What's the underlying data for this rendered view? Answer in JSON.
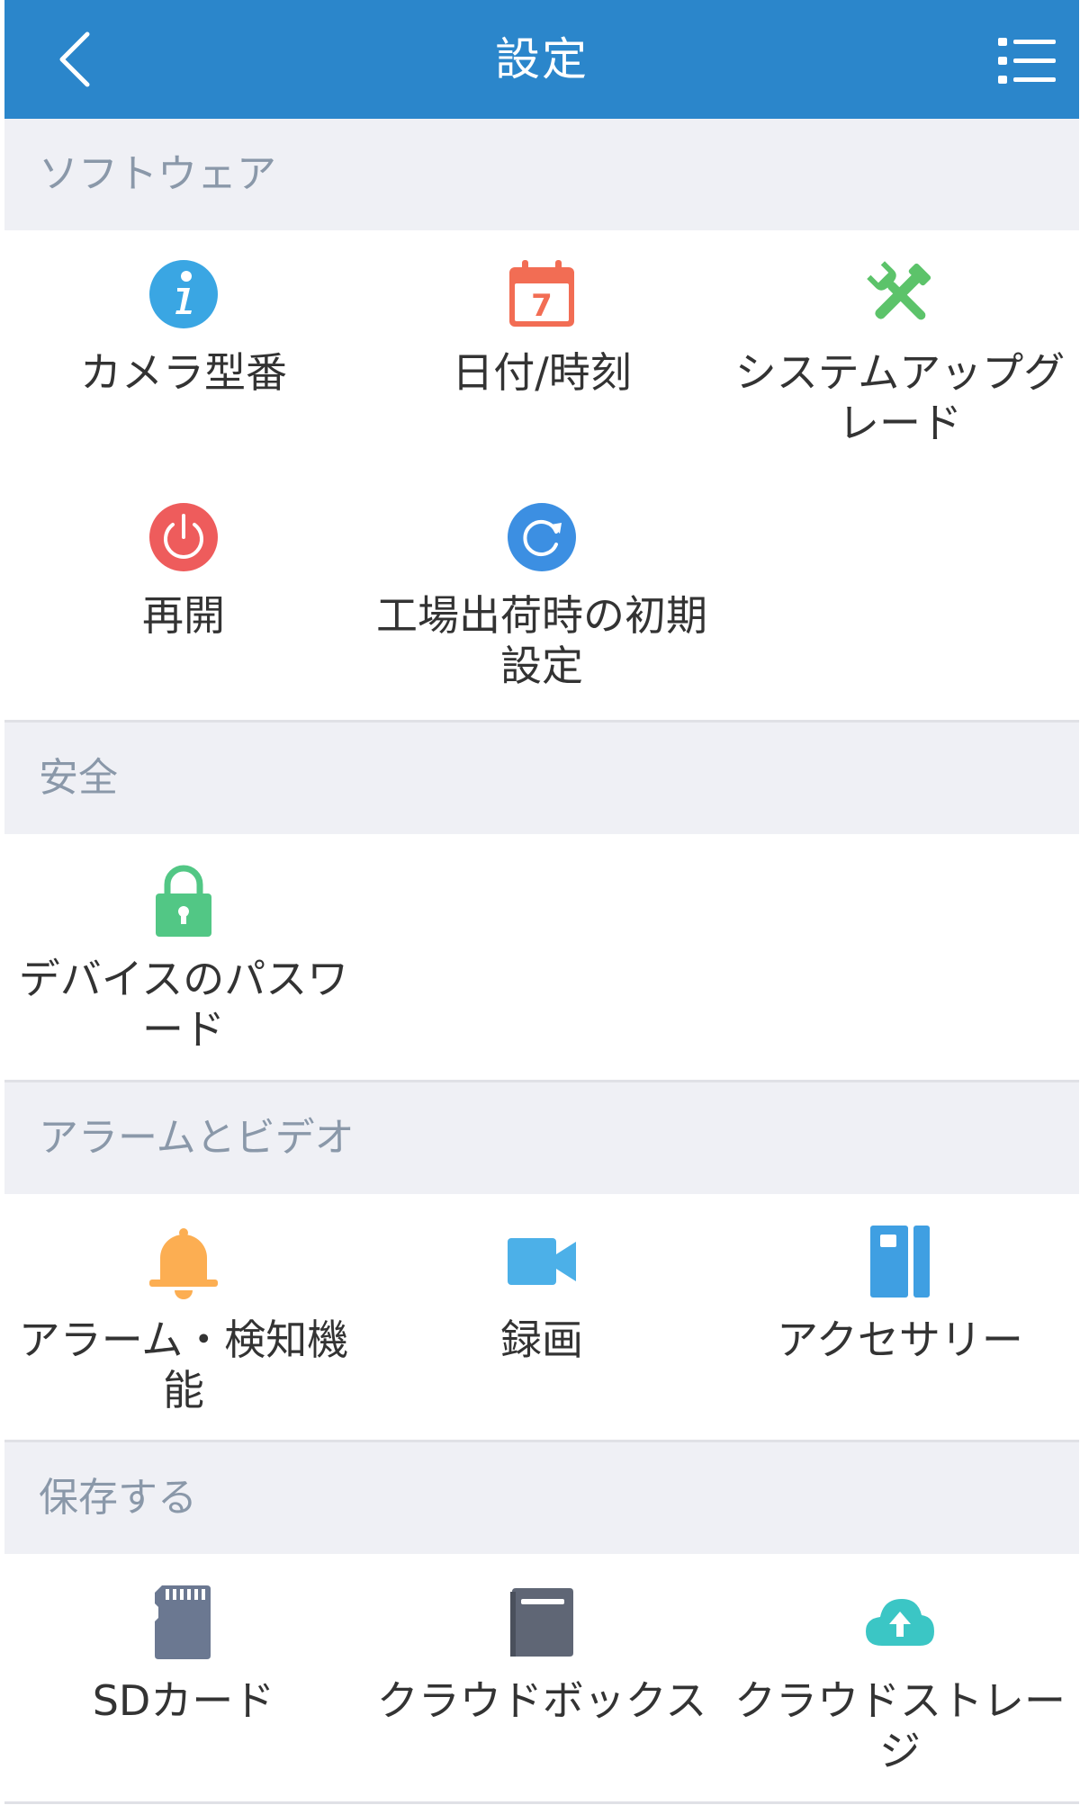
{
  "header": {
    "title": "設定",
    "back_icon": "chevron-left-icon",
    "menu_icon": "list-menu-icon",
    "background": "#2b86cb"
  },
  "sections": {
    "software": {
      "title": "ソフトウェア",
      "items": {
        "camera_model": {
          "label": "カメラ型番",
          "icon": "info-icon",
          "color": "#3aa6e3"
        },
        "datetime": {
          "label": "日付/時刻",
          "icon": "calendar-icon",
          "color": "#f26d54",
          "day": "7"
        },
        "upgrade": {
          "label": "システムアップグレード",
          "icon": "tools-icon",
          "color": "#5cc36a"
        },
        "reboot": {
          "label": "再開",
          "icon": "power-icon",
          "color": "#ee5c5c"
        },
        "factory_reset": {
          "label": "工場出荷時の初期設定",
          "icon": "reset-icon",
          "color": "#3c8fe2"
        }
      }
    },
    "security": {
      "title": "安全",
      "items": {
        "device_password": {
          "label": "デバイスのパスワード",
          "icon": "lock-icon",
          "color": "#52c785"
        }
      }
    },
    "alarm_video": {
      "title": "アラームとビデオ",
      "items": {
        "alarm_detection": {
          "label": "アラーム・検知機能",
          "icon": "bell-icon",
          "color": "#fcae52"
        },
        "recording": {
          "label": "録画",
          "icon": "video-camera-icon",
          "color": "#4cb0e8"
        },
        "accessory": {
          "label": "アクセサリー",
          "icon": "accessory-icon",
          "color": "#3f9fe2"
        }
      }
    },
    "storage": {
      "title": "保存する",
      "items": {
        "sd_card": {
          "label": "SDカード",
          "icon": "sd-card-icon",
          "color": "#6b7891"
        },
        "cloud_box": {
          "label": "クラウドボックス",
          "icon": "cloud-box-icon",
          "color": "#5f6675"
        },
        "cloud_storage": {
          "label": "クラウドストレージ",
          "icon": "cloud-upload-icon",
          "color": "#3bc6c5"
        }
      }
    }
  }
}
